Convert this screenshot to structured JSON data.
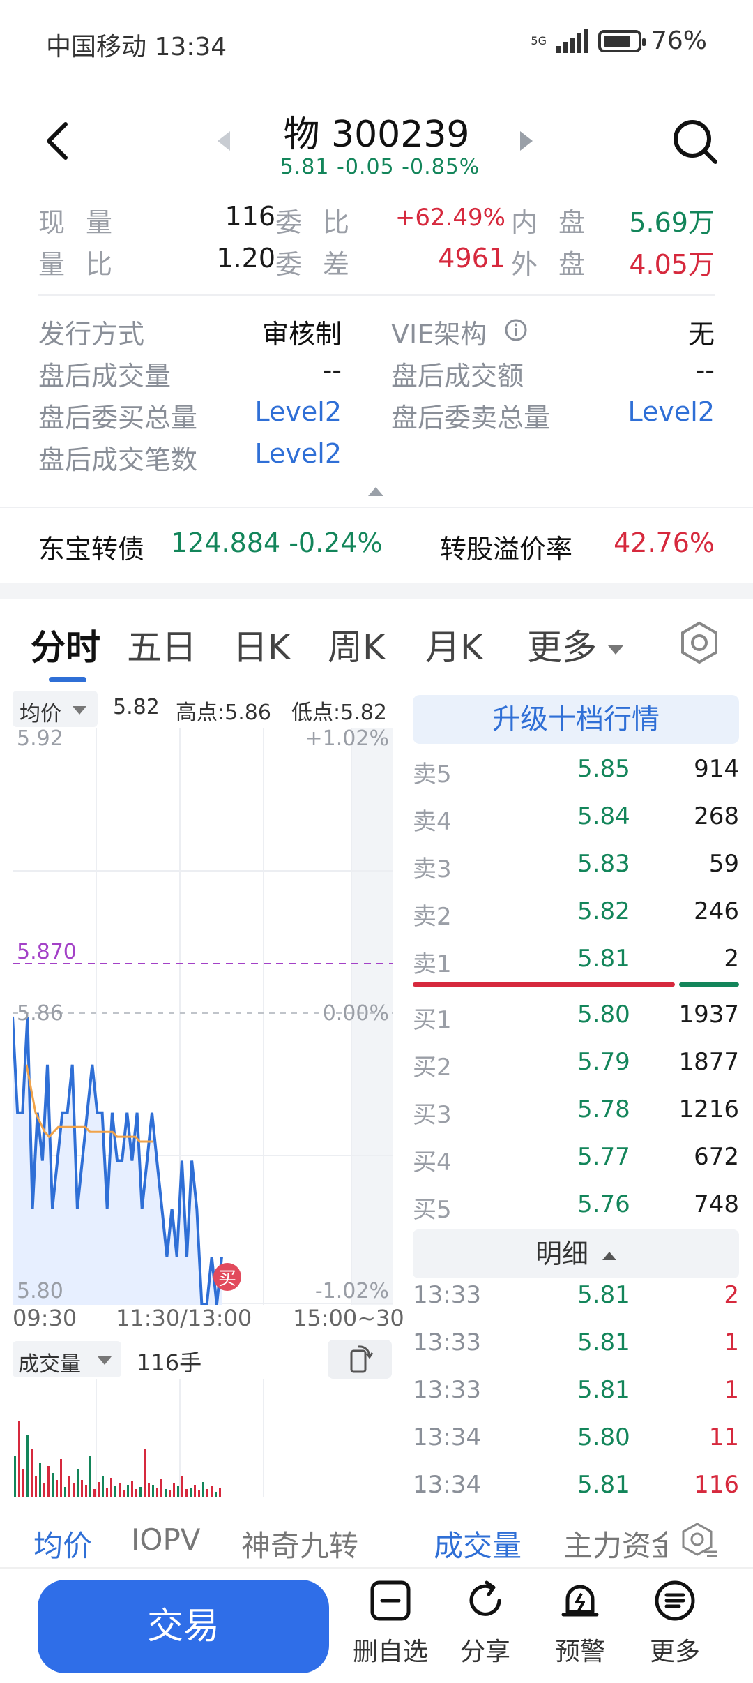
{
  "status": {
    "carrier_time": "中国移动 13:34",
    "network": "5G",
    "battery": "76%"
  },
  "header": {
    "title": "物 300239",
    "subtitle": "5.81 -0.05 -0.85%"
  },
  "quote": {
    "r1": {
      "l1": "现量",
      "v1": "116",
      "l2": "委比",
      "v2": "+62.49%",
      "l3": "内盘",
      "v3": "5.69万"
    },
    "r2": {
      "l1": "量比",
      "v1": "1.20",
      "l2": "委差",
      "v2": "4961",
      "l3": "外盘",
      "v3": "4.05万"
    }
  },
  "info": {
    "issue_label": "发行方式",
    "issue_val": "审核制",
    "vie_label": "VIE架构",
    "vie_val": "无",
    "ah_vol_label": "盘后成交量",
    "ah_vol_val": "--",
    "ah_amt_label": "盘后成交额",
    "ah_amt_val": "--",
    "ah_buy_label": "盘后委买总量",
    "ah_buy_val": "Level2",
    "ah_sell_label": "盘后委卖总量",
    "ah_sell_val": "Level2",
    "ah_cnt_label": "盘后成交笔数",
    "ah_cnt_val": "Level2"
  },
  "bond": {
    "label": "东宝转债",
    "value": "124.884 -0.24%",
    "premium_label": "转股溢价率",
    "premium_val": "42.76%"
  },
  "tabs": [
    "分时",
    "五日",
    "日K",
    "周K",
    "月K",
    "更多"
  ],
  "chart": {
    "avg_label": "均价",
    "price": "5.82",
    "high": "高点:5.86",
    "low": "低点:5.82",
    "y_top": "5.92",
    "pct_top": "+1.02%",
    "ref": "5.870",
    "mid": "5.86",
    "pct_mid": "0.00%",
    "y_bot": "5.80",
    "pct_bot": "-1.02%",
    "x_left": "09:30",
    "x_mid": "11:30/13:00",
    "x_right": "15:00~30",
    "buy_mark": "买",
    "vol_label": "成交量",
    "vol_val": "116手"
  },
  "chart_data": {
    "type": "line",
    "title": "",
    "xlabel": "",
    "ylabel": "",
    "ylim": [
      5.8,
      5.92
    ],
    "series": [
      {
        "values": [
          5.86,
          5.84,
          5.84,
          5.86,
          5.82,
          5.84,
          5.83,
          5.85,
          5.82,
          5.83,
          5.84,
          5.84,
          5.85,
          5.82,
          5.83,
          5.84,
          5.85,
          5.84,
          5.84,
          5.82,
          5.84,
          5.83,
          5.83,
          5.84,
          5.83,
          5.84,
          5.82,
          5.83,
          5.84,
          5.83,
          5.82,
          5.81,
          5.82,
          5.81,
          5.83,
          5.81,
          5.83,
          5.82,
          5.8,
          5.8,
          5.81,
          5.8,
          5.81
        ]
      },
      {
        "values": [
          5.85,
          5.845,
          5.84,
          5.838,
          5.836,
          5.835,
          5.836,
          5.837,
          5.837,
          5.837,
          5.837,
          5.837,
          5.837,
          5.837,
          5.836,
          5.836,
          5.836,
          5.836,
          5.836,
          5.836,
          5.835,
          5.835,
          5.835,
          5.835,
          5.835,
          5.834,
          5.834,
          5.834,
          5.834
        ]
      }
    ]
  },
  "order_book": {
    "header": "升级十档行情",
    "sells": [
      {
        "n": "卖5",
        "p": "5.85",
        "v": "914"
      },
      {
        "n": "卖4",
        "p": "5.84",
        "v": "268"
      },
      {
        "n": "卖3",
        "p": "5.83",
        "v": "59"
      },
      {
        "n": "卖2",
        "p": "5.82",
        "v": "246"
      },
      {
        "n": "卖1",
        "p": "5.81",
        "v": "2"
      }
    ],
    "buys": [
      {
        "n": "买1",
        "p": "5.80",
        "v": "1937"
      },
      {
        "n": "买2",
        "p": "5.79",
        "v": "1877"
      },
      {
        "n": "买3",
        "p": "5.78",
        "v": "1216"
      },
      {
        "n": "买4",
        "p": "5.77",
        "v": "672"
      },
      {
        "n": "买5",
        "p": "5.76",
        "v": "748"
      }
    ]
  },
  "detail": {
    "header": "明细",
    "rows": [
      {
        "t": "13:33",
        "p": "5.81",
        "v": "2"
      },
      {
        "t": "13:33",
        "p": "5.81",
        "v": "1"
      },
      {
        "t": "13:33",
        "p": "5.81",
        "v": "1"
      },
      {
        "t": "13:34",
        "p": "5.80",
        "v": "11"
      },
      {
        "t": "13:34",
        "p": "5.81",
        "v": "116"
      }
    ]
  },
  "indicators": [
    "均价",
    "IOPV",
    "神奇九转",
    "成交量",
    "主力资金"
  ],
  "bottom": {
    "trade": "交易",
    "del": "删自选",
    "share": "分享",
    "alert": "预警",
    "more": "更多"
  }
}
